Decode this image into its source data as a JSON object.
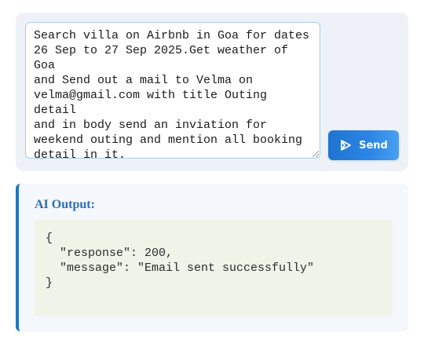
{
  "composer": {
    "prompt_text": "Search villa on Airbnb in Goa for dates\n26 Sep to 27 Sep 2025.Get weather of Goa\nand Send out a mail to Velma on\nvelma@gmail.com with title Outing detail\nand in body send an inviation for\nweekend outing and mention all booking\ndetail in it.",
    "send_label": "Send",
    "send_icon": "send-icon"
  },
  "output": {
    "title": "AI Output:",
    "code": "{\n  \"response\": 200,\n  \"message\": \"Email sent successfully\"\n}"
  },
  "colors": {
    "accent": "#1f74c4",
    "button_start": "#1f73d0",
    "button_end": "#4a9ff0",
    "code_bg": "#eef5e8",
    "card_bg": "#eef2f8"
  }
}
